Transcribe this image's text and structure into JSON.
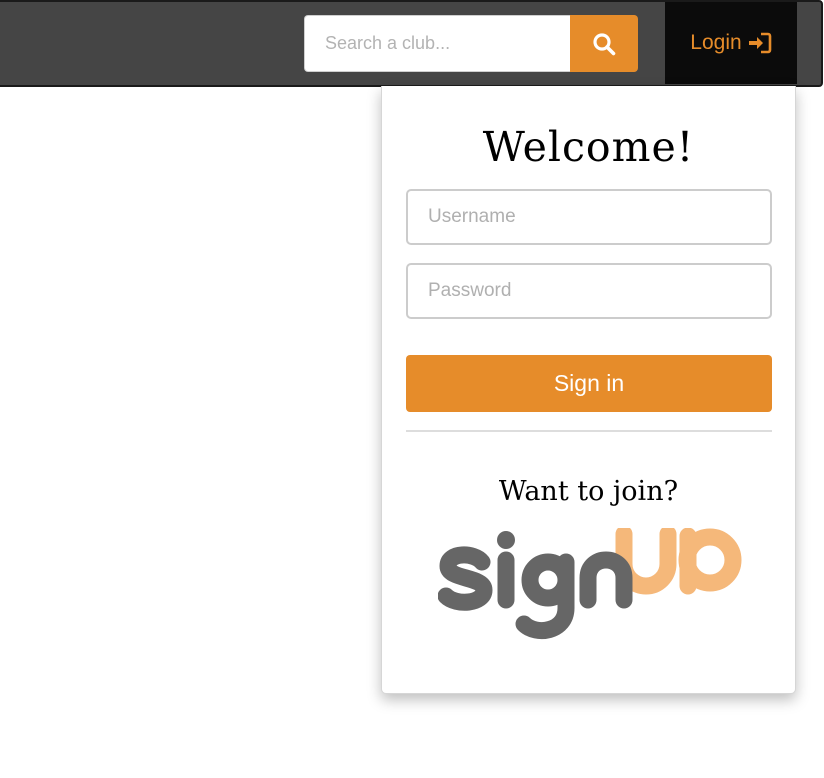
{
  "search": {
    "placeholder": "Search a club...",
    "icon": "search-icon"
  },
  "nav": {
    "login_label": "Login",
    "login_icon": "sign-in-icon"
  },
  "login_panel": {
    "title": "Welcome!",
    "username_placeholder": "Username",
    "password_placeholder": "Password",
    "signin_label": "Sign in",
    "join_prompt": "Want to join?",
    "signup_logo_text": "signUP"
  },
  "colors": {
    "accent": "#e68c2a",
    "navbar": "#454545",
    "login_tab": "#0b0b0b",
    "logo_gray": "#666666",
    "logo_orange": "#f5b87a"
  }
}
